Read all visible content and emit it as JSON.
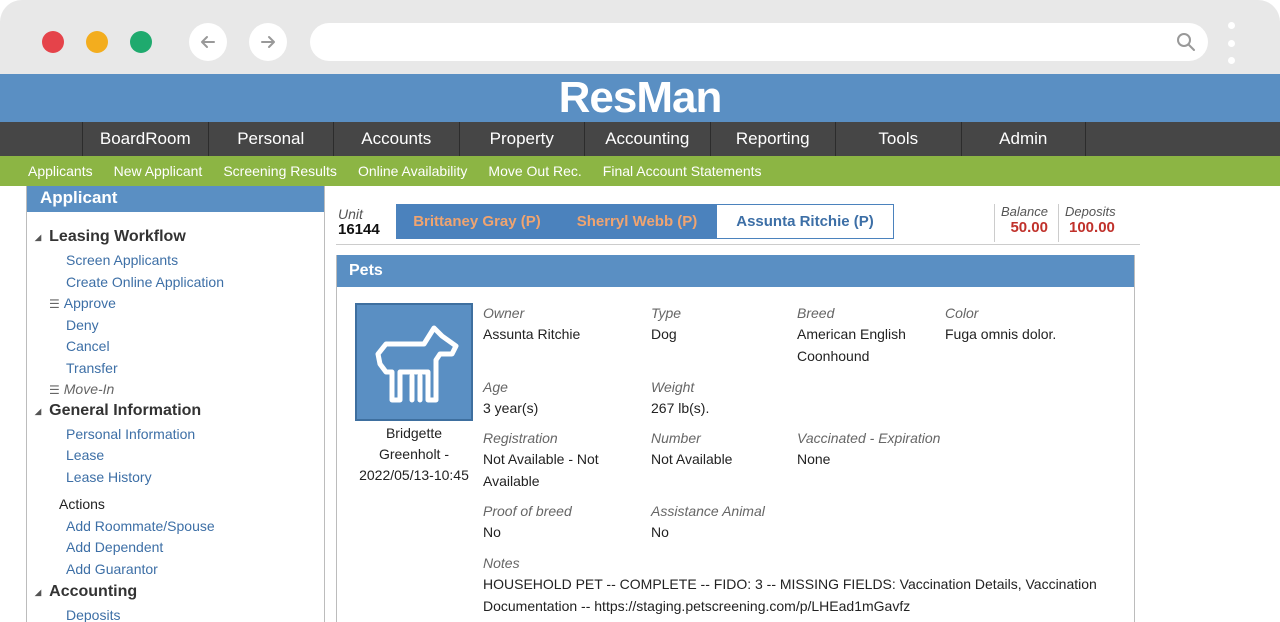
{
  "browser": {
    "colors": {
      "red": "#e5434a",
      "yellow": "#f3ad1e",
      "green": "#1faa6e"
    }
  },
  "app": {
    "logo": "ResMan",
    "main_nav": [
      "BoardRoom",
      "Personal",
      "Accounts",
      "Property",
      "Accounting",
      "Reporting",
      "Tools",
      "Admin"
    ],
    "sub_nav": [
      "Applicants",
      "New Applicant",
      "Screening Results",
      "Online Availability",
      "Move Out Rec.",
      "Final Account Statements"
    ]
  },
  "sidebar": {
    "title": "Applicant",
    "leasing_workflow": {
      "label": "Leasing Workflow",
      "items": [
        "Screen Applicants",
        "Create Online Application",
        "Approve",
        "Deny",
        "Cancel",
        "Transfer",
        "Move-In"
      ]
    },
    "general_information": {
      "label": "General Information",
      "items": [
        "Personal Information",
        "Lease",
        "Lease History"
      ]
    },
    "actions": {
      "label": "Actions",
      "items": [
        "Add Roommate/Spouse",
        "Add Dependent",
        "Add Guarantor"
      ]
    },
    "accounting": {
      "label": "Accounting",
      "items": [
        "Deposits"
      ]
    }
  },
  "header": {
    "unit_label": "Unit",
    "unit_value": "16144",
    "tabs": [
      "Brittaney Gray (P)",
      "Sherryl Webb (P)",
      "Assunta Ritchie (P)"
    ],
    "active_tab": "Assunta Ritchie (P)",
    "balance_label": "Balance",
    "balance_value": "50.00",
    "deposits_label": "Deposits",
    "deposits_value": "100.00"
  },
  "pets": {
    "title": "Pets",
    "pet_icon": "dog-icon",
    "caption": [
      "Bridgette",
      "Greenholt -",
      "2022/05/13-10:45"
    ],
    "owner_label": "Owner",
    "owner": "Assunta Ritchie",
    "type_label": "Type",
    "type": "Dog",
    "breed_label": "Breed",
    "breed_lines": [
      "American English",
      "Coonhound"
    ],
    "color_label": "Color",
    "color": "Fuga omnis dolor.",
    "age_label": "Age",
    "age": "3 year(s)",
    "weight_label": "Weight",
    "weight": "267 lb(s).",
    "registration_label": "Registration",
    "registration_lines": [
      "Not Available - Not",
      "Available"
    ],
    "number_label": "Number",
    "number": "Not Available",
    "vaccinated_label": "Vaccinated - Expiration",
    "vaccinated": "None",
    "proof_label": "Proof of breed",
    "proof": "No",
    "assistance_label": "Assistance Animal",
    "assistance": "No",
    "notes_label": "Notes",
    "notes_lines": [
      "HOUSEHOLD PET -- COMPLETE -- FIDO: 3 -- MISSING FIELDS: Vaccination Details, Vaccination",
      "Documentation -- https://staging.petscreening.com/p/LHEad1mGavfz"
    ]
  }
}
